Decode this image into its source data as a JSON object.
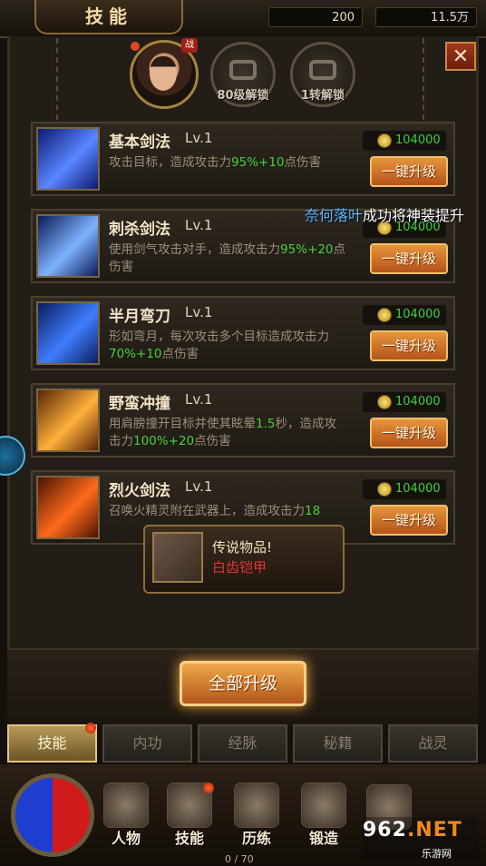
{
  "header": {
    "title": "技能"
  },
  "resources": {
    "ingot": "200",
    "gold": "11.5万"
  },
  "hero": {
    "badge": "战"
  },
  "locked_slots": [
    "80级解锁",
    "1转解锁"
  ],
  "cost_label": "104000",
  "upgrade_label": "一键升级",
  "skills": [
    {
      "name": "基本剑法",
      "level": "Lv.1",
      "desc_pre": "攻击目标，造成攻击力",
      "desc_hl": "95%+10",
      "desc_post": "点伤害",
      "colors": [
        "#0c1a6e",
        "#5a86ff"
      ]
    },
    {
      "name": "刺杀剑法",
      "level": "Lv.1",
      "desc_pre": "使用剑气攻击对手，造成攻击力",
      "desc_hl": "95%+20",
      "desc_post": "点伤害",
      "colors": [
        "#0a1a55",
        "#7fb2ff"
      ]
    },
    {
      "name": "半月弯刀",
      "level": "Lv.1",
      "desc_pre": "形如弯月，每次攻击多个目标造成攻击力",
      "desc_hl": "70%+10",
      "desc_post": "点伤害",
      "colors": [
        "#0b1d5c",
        "#3f7dff"
      ]
    },
    {
      "name": "野蛮冲撞",
      "level": "Lv.1",
      "desc_pre": "用肩膀撞开目标并使其眩晕",
      "desc_hl": "1.5",
      "desc_post": "秒，造成攻击力",
      "desc_hl2": "100%+20",
      "desc_post2": "点伤害",
      "colors": [
        "#5a2405",
        "#ffb13a"
      ]
    },
    {
      "name": "烈火剑法",
      "level": "Lv.1",
      "desc_pre": "召唤火精灵附在武器上，造成攻击力",
      "desc_hl": "18",
      "desc_post": "",
      "colors": [
        "#4a1404",
        "#ff6a1a"
      ]
    }
  ],
  "scroll_message": {
    "name": "奈何落叶",
    "text": "成功将神装提升"
  },
  "toast": {
    "title": "传说物品!",
    "item": "白齿铠甲"
  },
  "upgrade_all": "全部升级",
  "sub_tabs": [
    "技能",
    "内功",
    "经脉",
    "秘籍",
    "战灵"
  ],
  "nav": [
    "人物",
    "技能",
    "历练",
    "锻造"
  ],
  "page_count": "0 / 70",
  "watermark": {
    "big_a": "962",
    "big_b": ".NET",
    "small": "乐游网"
  },
  "colors": {
    "accent": "#e6953b",
    "cost_green": "#3fcf3a",
    "highlight_red": "#e2333a"
  }
}
